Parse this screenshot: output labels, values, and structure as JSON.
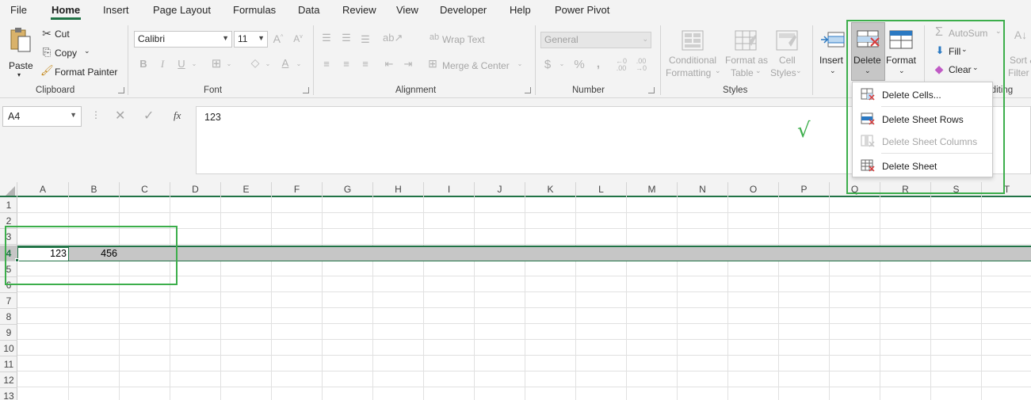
{
  "tabs": [
    "File",
    "Home",
    "Insert",
    "Page Layout",
    "Formulas",
    "Data",
    "Review",
    "View",
    "Developer",
    "Help",
    "Power Pivot"
  ],
  "clipboard": {
    "paste": "Paste",
    "cut": "Cut",
    "copy": "Copy",
    "format_painter": "Format Painter",
    "label": "Clipboard"
  },
  "font": {
    "name": "Calibri",
    "size": "11",
    "label": "Font"
  },
  "alignment": {
    "wrap_text": "Wrap Text",
    "merge_center": "Merge & Center",
    "label": "Alignment"
  },
  "number": {
    "format": "General",
    "label": "Number"
  },
  "styles": {
    "conditional_1": "Conditional",
    "conditional_2": "Formatting",
    "format_table_1": "Format as",
    "format_table_2": "Table",
    "cell_styles_1": "Cell",
    "cell_styles_2": "Styles",
    "label": "Styles"
  },
  "cells_group": {
    "insert": "Insert",
    "delete": "Delete",
    "format": "Format"
  },
  "editing": {
    "autosum": "AutoSum",
    "fill": "Fill",
    "clear": "Clear",
    "sort_1": "Sort &",
    "sort_2": "Filter",
    "label": "Editing"
  },
  "formula_bar": {
    "name_box": "A4",
    "content": "123",
    "fx": "fx"
  },
  "columns": [
    "A",
    "B",
    "C",
    "D",
    "E",
    "F",
    "G",
    "H",
    "I",
    "J",
    "K",
    "L",
    "M",
    "N",
    "O",
    "P",
    "Q",
    "R",
    "S",
    "T"
  ],
  "rows": [
    "1",
    "2",
    "3",
    "4",
    "5",
    "6",
    "7",
    "8",
    "9",
    "10",
    "11",
    "12",
    "13"
  ],
  "cells": {
    "A4": "123",
    "B4": "456"
  },
  "delete_menu": {
    "items": [
      {
        "label": "Delete Cells...",
        "enabled": true
      },
      {
        "label": "Delete Sheet Rows",
        "enabled": true
      },
      {
        "label": "Delete Sheet Columns",
        "enabled": false
      },
      {
        "label": "Delete Sheet",
        "enabled": true
      }
    ]
  },
  "annotation": {
    "check_mark": "√"
  },
  "colors": {
    "accent": "#217346",
    "annotation": "#3cae4b",
    "ribbon_bg": "#f3f3f3"
  }
}
